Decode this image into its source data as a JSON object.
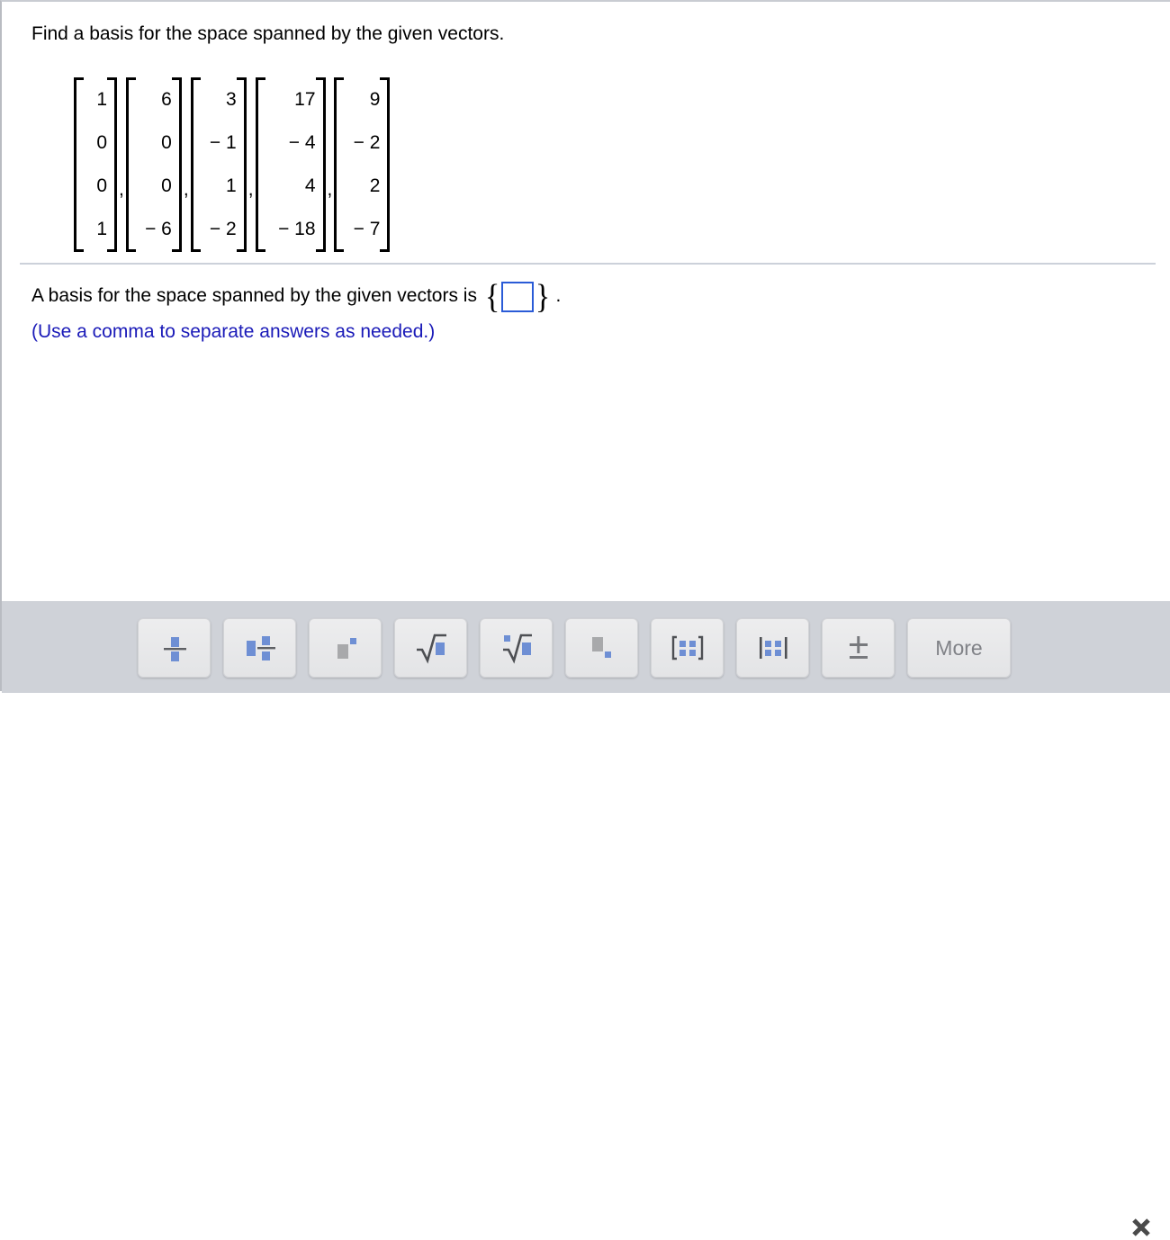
{
  "question": {
    "prompt": "Find a basis for the space spanned by the given vectors."
  },
  "vectors": [
    {
      "entries": [
        "1",
        "0",
        "0",
        "1"
      ]
    },
    {
      "entries": [
        "6",
        "0",
        "0",
        "− 6"
      ]
    },
    {
      "entries": [
        "3",
        "− 1",
        "1",
        "− 2"
      ]
    },
    {
      "entries": [
        "17",
        "− 4",
        "4",
        "− 18"
      ]
    },
    {
      "entries": [
        "9",
        "− 2",
        "2",
        "− 7"
      ]
    }
  ],
  "separator": ",",
  "answer": {
    "lead_text": "A basis for the space spanned by the given vectors is",
    "open_brace": "{",
    "close_brace": "}",
    "input_value": "",
    "input_placeholder": "",
    "period": ".",
    "hint": "(Use a comma to separate answers as needed.)"
  },
  "toolbar": {
    "buttons": [
      {
        "name": "fraction-button",
        "icon": "fraction-icon",
        "label": ""
      },
      {
        "name": "mixed-number-button",
        "icon": "mixed-number-icon",
        "label": ""
      },
      {
        "name": "exponent-button",
        "icon": "exponent-icon",
        "label": ""
      },
      {
        "name": "square-root-button",
        "icon": "square-root-icon",
        "label": ""
      },
      {
        "name": "nth-root-button",
        "icon": "nth-root-icon",
        "label": ""
      },
      {
        "name": "subscript-button",
        "icon": "subscript-icon",
        "label": ""
      },
      {
        "name": "matrix-brackets-button",
        "icon": "matrix-brackets-icon",
        "label": ""
      },
      {
        "name": "determinant-bars-button",
        "icon": "determinant-bars-icon",
        "label": ""
      },
      {
        "name": "plus-minus-button",
        "icon": "plus-minus-icon",
        "label": ""
      },
      {
        "name": "more-button",
        "icon": "",
        "label": "More"
      }
    ],
    "close_label": "✕"
  },
  "colors": {
    "accent_blue": "#6e8fd4",
    "input_border": "#2a5bd7",
    "hint_text": "#1a1ab8",
    "toolbar_bg": "#cfd2d8",
    "button_bg": "#e8e9eb",
    "icon_gray": "#a8a9ab",
    "more_text": "#808287"
  }
}
